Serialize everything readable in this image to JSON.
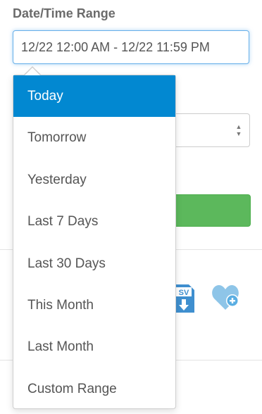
{
  "filter": {
    "label": "Date/Time Range",
    "value": "12/22 12:00 AM - 12/22 11:59 PM"
  },
  "range_menu": {
    "selected": "Today",
    "options": [
      "Today",
      "Tomorrow",
      "Yesterday",
      "Last 7 Days",
      "Last 30 Days",
      "This Month",
      "Last Month",
      "Custom Range"
    ]
  },
  "colors": {
    "accent": "#0288d1",
    "success": "#5cb85c",
    "icon_blue": "#4a9fd8",
    "heart_blue": "#8ec5e8"
  },
  "icons": {
    "csv": "csv-download-icon",
    "heart": "heart-plus-icon"
  }
}
